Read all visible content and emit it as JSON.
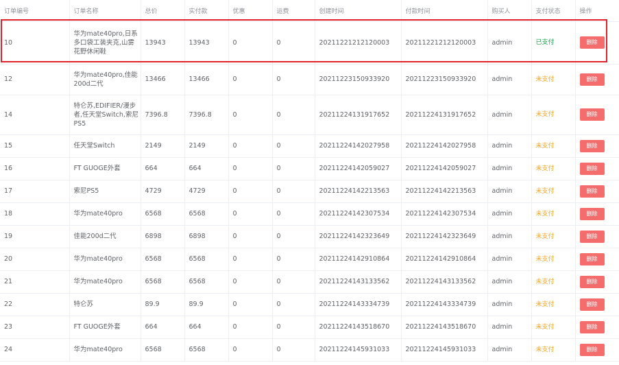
{
  "headers": [
    "订单编号",
    "订单名称",
    "总价",
    "实付款",
    "优惠",
    "运费",
    "创建时间",
    "付款时间",
    "购买人",
    "支付状态",
    "操作"
  ],
  "delete_label": "删除",
  "rows": [
    {
      "id": "10",
      "name": "华为mate40pro,日系多口袋工装夹克,山雾花野休闲鞋",
      "total": "13943",
      "paid": "13943",
      "discount": "0",
      "shipping": "0",
      "created": "20211221212120003",
      "pay_time": "20211221212120003",
      "buyer": "admin",
      "status": "已支付",
      "paid_flag": true,
      "lines": 3
    },
    {
      "id": "12",
      "name": "华为mate40pro,佳能200d二代",
      "total": "13466",
      "paid": "13466",
      "discount": "0",
      "shipping": "0",
      "created": "20211223150933920",
      "pay_time": "20211223150933920",
      "buyer": "admin",
      "status": "未支付",
      "paid_flag": false,
      "lines": 2
    },
    {
      "id": "14",
      "name": "特仑苏,EDIFIER/漫步者,任天堂Switch,索尼PS5",
      "total": "7396.8",
      "paid": "7396.8",
      "discount": "0",
      "shipping": "0",
      "created": "20211224131917652",
      "pay_time": "20211224131917652",
      "buyer": "admin",
      "status": "未支付",
      "paid_flag": false,
      "lines": 3
    },
    {
      "id": "15",
      "name": "任天堂Switch",
      "total": "2149",
      "paid": "2149",
      "discount": "0",
      "shipping": "0",
      "created": "20211224142027958",
      "pay_time": "20211224142027958",
      "buyer": "admin",
      "status": "未支付",
      "paid_flag": false,
      "lines": 1
    },
    {
      "id": "16",
      "name": "FT GUOGE外套",
      "total": "664",
      "paid": "664",
      "discount": "0",
      "shipping": "0",
      "created": "20211224142059027",
      "pay_time": "20211224142059027",
      "buyer": "admin",
      "status": "未支付",
      "paid_flag": false,
      "lines": 1
    },
    {
      "id": "17",
      "name": "索尼PS5",
      "total": "4729",
      "paid": "4729",
      "discount": "0",
      "shipping": "0",
      "created": "20211224142213563",
      "pay_time": "20211224142213563",
      "buyer": "admin",
      "status": "未支付",
      "paid_flag": false,
      "lines": 1
    },
    {
      "id": "18",
      "name": "华为mate40pro",
      "total": "6568",
      "paid": "6568",
      "discount": "0",
      "shipping": "0",
      "created": "20211224142307534",
      "pay_time": "20211224142307534",
      "buyer": "admin",
      "status": "未支付",
      "paid_flag": false,
      "lines": 1
    },
    {
      "id": "19",
      "name": "佳能200d二代",
      "total": "6898",
      "paid": "6898",
      "discount": "0",
      "shipping": "0",
      "created": "20211224142323649",
      "pay_time": "20211224142323649",
      "buyer": "admin",
      "status": "未支付",
      "paid_flag": false,
      "lines": 1
    },
    {
      "id": "20",
      "name": "华为mate40pro",
      "total": "6568",
      "paid": "6568",
      "discount": "0",
      "shipping": "0",
      "created": "20211224142910864",
      "pay_time": "20211224142910864",
      "buyer": "admin",
      "status": "未支付",
      "paid_flag": false,
      "lines": 1
    },
    {
      "id": "21",
      "name": "华为mate40pro",
      "total": "6568",
      "paid": "6568",
      "discount": "0",
      "shipping": "0",
      "created": "20211224143133562",
      "pay_time": "20211224143133562",
      "buyer": "admin",
      "status": "未支付",
      "paid_flag": false,
      "lines": 1
    },
    {
      "id": "22",
      "name": "特仑苏",
      "total": "89.9",
      "paid": "89.9",
      "discount": "0",
      "shipping": "0",
      "created": "20211224143334739",
      "pay_time": "20211224143334739",
      "buyer": "admin",
      "status": "未支付",
      "paid_flag": false,
      "lines": 1
    },
    {
      "id": "23",
      "name": "FT GUOGE外套",
      "total": "664",
      "paid": "664",
      "discount": "0",
      "shipping": "0",
      "created": "20211224143518670",
      "pay_time": "20211224143518670",
      "buyer": "admin",
      "status": "未支付",
      "paid_flag": false,
      "lines": 1
    },
    {
      "id": "24",
      "name": "华为mate40pro",
      "total": "6568",
      "paid": "6568",
      "discount": "0",
      "shipping": "0",
      "created": "20211224145931033",
      "pay_time": "20211224145931033",
      "buyer": "admin",
      "status": "未支付",
      "paid_flag": false,
      "lines": 1
    }
  ]
}
